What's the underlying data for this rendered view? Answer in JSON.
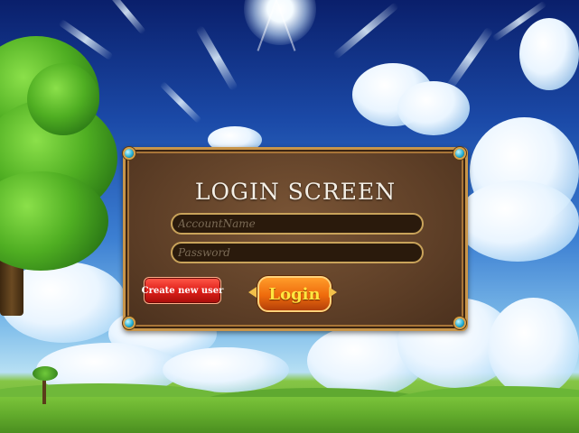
{
  "login": {
    "title": "LOGIN SCREEN",
    "account_placeholder": "AccountName",
    "password_placeholder": "Password",
    "create_user_label": "Create new user",
    "login_label": "Login"
  },
  "colors": {
    "panel": "#5e3f27",
    "panel_border": "#c8954a",
    "create_button": "#e0201a",
    "login_button": "#ee6a0c",
    "login_text": "#ffe640",
    "gem": "#27b2d6"
  },
  "icons": {
    "corner": "gem-ornament-icon",
    "login_arrows": "arrow-ornament-icon"
  }
}
